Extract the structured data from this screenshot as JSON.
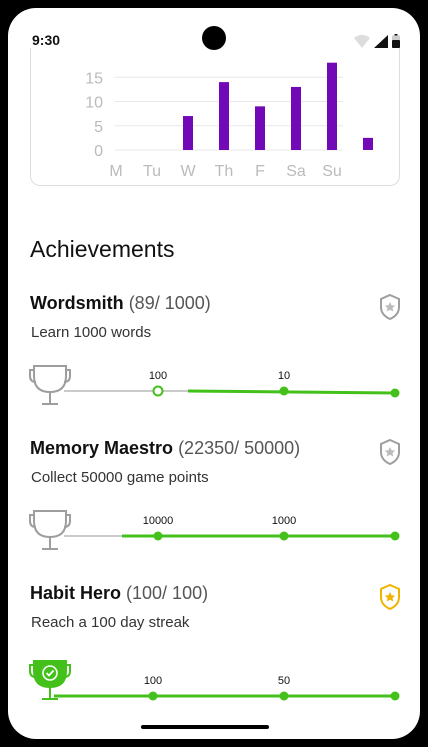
{
  "status_bar": {
    "time": "9:30"
  },
  "colors": {
    "accent_purple": "#7209b7",
    "progress_green": "#43c11a",
    "gold": "#f0b400",
    "gray": "#9e9e9e"
  },
  "chart_data": {
    "type": "bar",
    "categories": [
      "M",
      "Tu",
      "W",
      "Th",
      "F",
      "Sa",
      "Su"
    ],
    "values": [
      0,
      7,
      14,
      9,
      13,
      18,
      2.5
    ],
    "title": "",
    "xlabel": "",
    "ylabel": "",
    "y_ticks": [
      "0",
      "5",
      "10",
      "15"
    ],
    "ylim": [
      0,
      18
    ],
    "grid": true
  },
  "achievements": {
    "title": "Achievements",
    "items": [
      {
        "name": "Wordsmith",
        "progress": "(89/ 1000)",
        "description": "Learn 1000 words",
        "badge_state": "locked",
        "trophy_state": "locked",
        "milestone_labels": [
          "100",
          "10"
        ],
        "fraction": 0.089
      },
      {
        "name": "Memory Maestro",
        "progress": "(22350/ 50000)",
        "description": "Collect 50000 game points",
        "badge_state": "locked",
        "trophy_state": "locked",
        "milestone_labels": [
          "10000",
          "1000"
        ],
        "fraction": 0.447
      },
      {
        "name": "Habit Hero",
        "progress": "(100/ 100)",
        "description": "Reach a 100 day streak",
        "badge_state": "earned",
        "trophy_state": "earned",
        "milestone_labels": [
          "100",
          "50"
        ],
        "fraction": 1.0
      }
    ]
  }
}
